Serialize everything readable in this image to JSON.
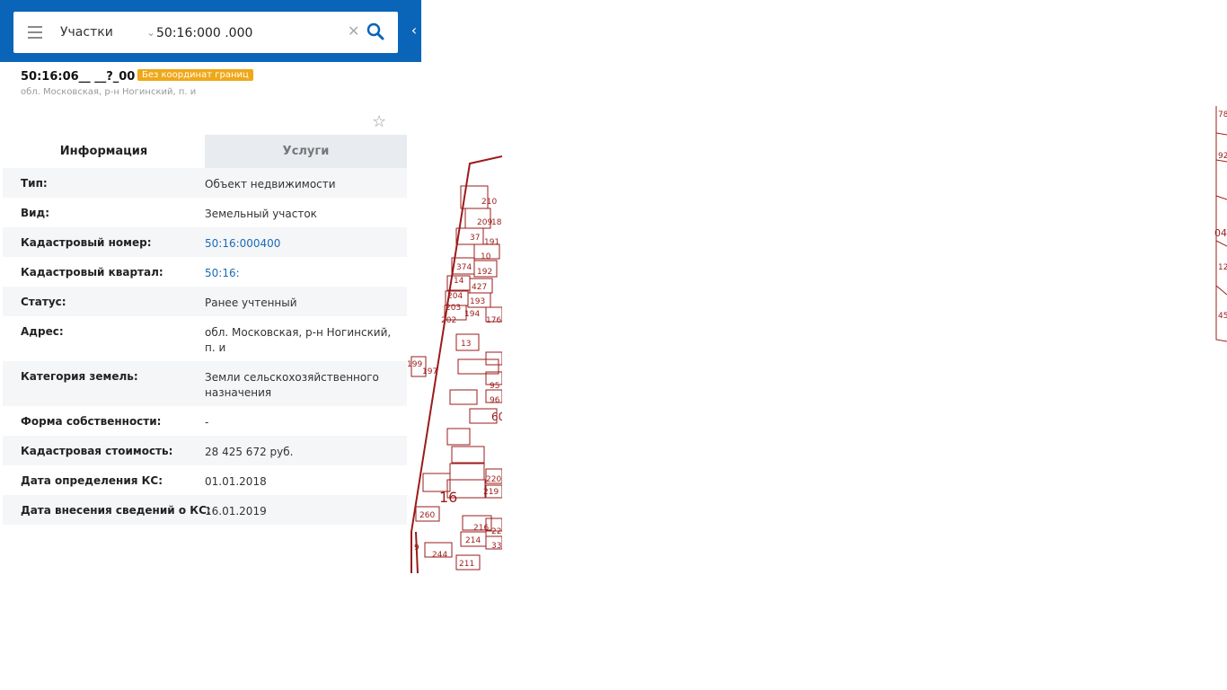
{
  "search": {
    "layer": "Участки",
    "query": "50:16:000 .000"
  },
  "object": {
    "number": "50:16:06__ __?_00",
    "badge": "Без координат границ",
    "address": "обл. Московская, р-н Ногинский, п. и"
  },
  "tabs": [
    {
      "label": "Информация",
      "active": true
    },
    {
      "label": "Услуги",
      "active": false
    }
  ],
  "info": [
    {
      "key": "Тип:",
      "value": "Объект недвижимости"
    },
    {
      "key": "Вид:",
      "value": "Земельный участок"
    },
    {
      "key": "Кадастровый номер:",
      "value": "50:16:000400"
    },
    {
      "key": "Кадастровый квартал:",
      "value": "50:16:"
    },
    {
      "key": "Статус:",
      "value": "Ранее учтенный"
    },
    {
      "key": "Адрес:",
      "value": "обл. Московская, р-н Ногинский, п. и"
    },
    {
      "key": "Категория земель:",
      "value": "Земли сельскохозяйственного назначения"
    },
    {
      "key": "Форма собственности:",
      "value": "-"
    },
    {
      "key": "Кадастровая стоимость:",
      "value": "28 425 672 руб."
    },
    {
      "key": "Дата определения КС:",
      "value": "01.01.2018"
    },
    {
      "key": "Дата внесения сведений о КС:",
      "value": "16.01.2019"
    }
  ],
  "map": {
    "parcel_labels": [
      "210",
      "209",
      "189",
      "37",
      "191",
      "10",
      "374",
      "192",
      "14",
      "427",
      "204",
      "193",
      "203",
      "194",
      "202",
      "176",
      "13",
      "199",
      "197",
      "95",
      "96",
      "60",
      "220",
      "219",
      "16",
      "260",
      "216",
      "214",
      "211",
      "9",
      "244",
      "33",
      "22"
    ],
    "right_labels": [
      "78",
      "92",
      "04",
      "12",
      "45"
    ],
    "line_color": "#9b1b1b"
  },
  "colors": {
    "header": "#0a64b8",
    "badge": "#f0a818",
    "link": "#1a6bb5"
  }
}
